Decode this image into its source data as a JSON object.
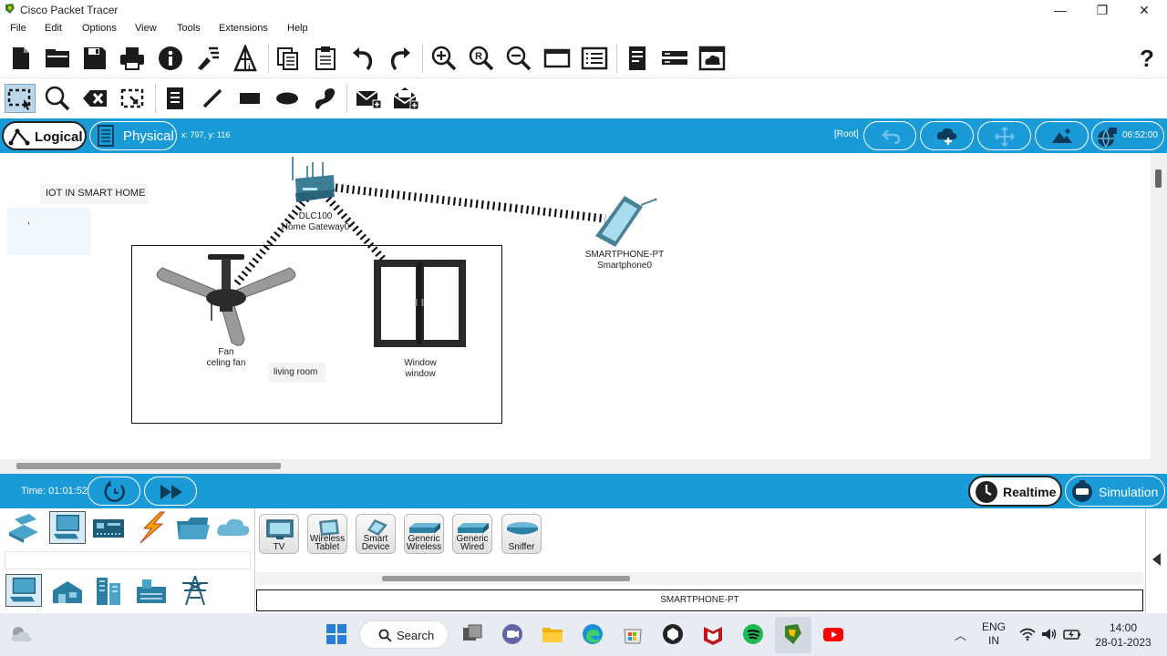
{
  "window": {
    "title": "Cisco Packet Tracer",
    "min_glyph": "—",
    "max_glyph": "❐",
    "close_glyph": "✕"
  },
  "menu": [
    "File",
    "Edit",
    "Options",
    "View",
    "Tools",
    "Extensions",
    "Help"
  ],
  "toolbar_main": {
    "help_glyph": "?",
    "icons": [
      "new-file-icon",
      "open-folder-icon",
      "save-icon",
      "print-icon",
      "info-icon",
      "activity-wizard-icon",
      "network-info-icon",
      "copy-icon",
      "paste-icon",
      "undo-icon",
      "redo-icon",
      "zoom-in-icon",
      "zoom-reset-icon",
      "zoom-out-icon",
      "drawing-palette-icon",
      "custom-device-dialog-icon",
      "view-command-log-icon",
      "cluster-icon",
      "cloud-view-icon"
    ]
  },
  "toolbar_tools": {
    "icons": [
      "select-icon",
      "inspect-icon",
      "delete-icon",
      "resize-shape-icon",
      "place-note-icon",
      "draw-line-icon",
      "draw-rectangle-icon",
      "draw-ellipse-icon",
      "freeform-icon",
      "add-simple-pdu-icon",
      "add-complex-pdu-icon"
    ]
  },
  "viewbar": {
    "logical_label": "Logical",
    "physical_label": "Physical",
    "coords": "x: 797, y: 116",
    "root_label": "[Root]",
    "clock": "06:52:00"
  },
  "canvas": {
    "note_title": "IOT IN SMART HOME",
    "note_comma": ",",
    "gateway": {
      "line1": "DLC100",
      "line2": "Home Gateway0"
    },
    "smartphone": {
      "line1": "SMARTPHONE-PT",
      "line2": "Smartphone0"
    },
    "fan": {
      "line1": "Fan",
      "line2": "celing fan"
    },
    "window_device": {
      "line1": "Window",
      "line2": "window"
    },
    "room_label": "living room"
  },
  "sim_bar": {
    "time": "Time: 01:01:52",
    "realtime_label": "Realtime",
    "simulation_label": "Simulation"
  },
  "device_list": [
    {
      "line1": "TV",
      "line2": ""
    },
    {
      "line1": "Wireless",
      "line2": "Tablet"
    },
    {
      "line1": "Smart",
      "line2": "Device"
    },
    {
      "line1": "Generic",
      "line2": "Wireless"
    },
    {
      "line1": "Generic",
      "line2": "Wired"
    },
    {
      "line1": "Sniffer",
      "line2": ""
    }
  ],
  "selected_device_name": "SMARTPHONE-PT",
  "taskbar": {
    "search_label": "Search",
    "lang1": "ENG",
    "lang2": "IN",
    "time": "14:00",
    "date": "28-01-2023",
    "chevron_glyph": "︿"
  },
  "colors": {
    "accent_blue": "#1a9ad6"
  }
}
